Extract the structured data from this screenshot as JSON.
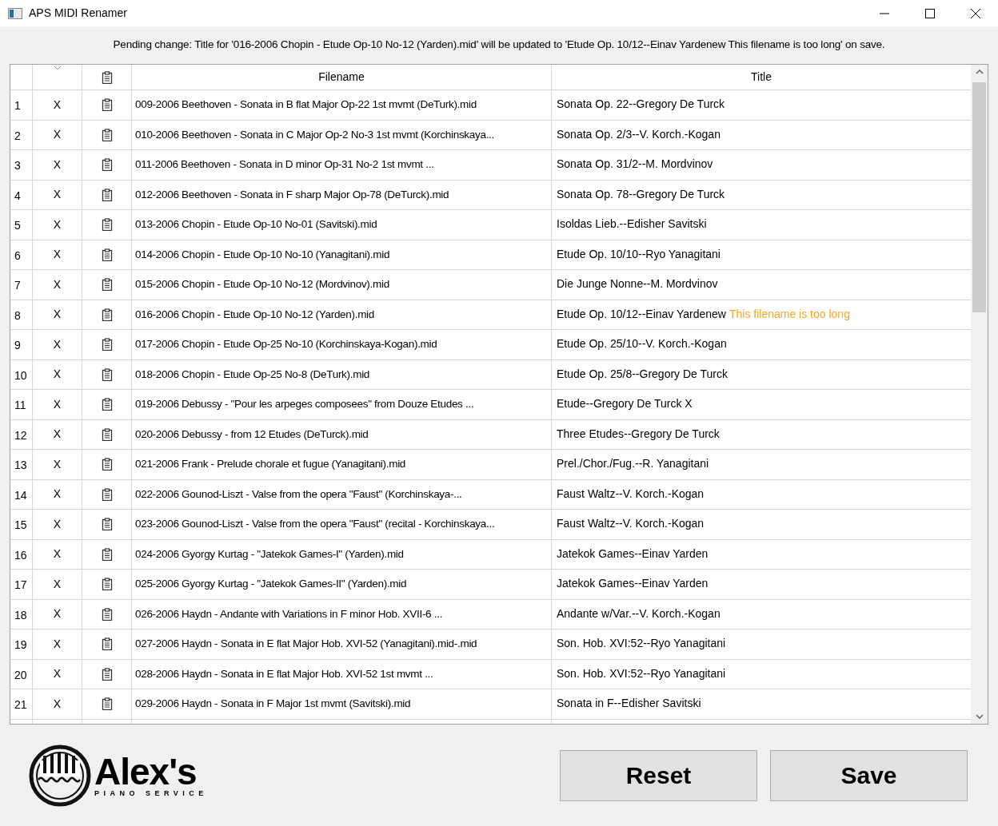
{
  "window": {
    "title": "APS MIDI Renamer"
  },
  "pending_change": "Pending change: Title for '016-2006 Chopin - Etude Op-10 No-12 (Yarden).mid' will be updated to 'Etude Op. 10/12--Einav Yardenew This filename is too long' on save.",
  "table": {
    "columns": [
      "Filename",
      "Title"
    ],
    "rows": [
      {
        "number": "1",
        "mark": "X",
        "filename": "009-2006 Beethoven - Sonata in B flat Major Op-22 1st mvmt (DeTurk).mid",
        "title": "Sonata Op. 22--Gregory De Turck"
      },
      {
        "number": "2",
        "mark": "X",
        "filename": "010-2006 Beethoven - Sonata in C Major Op-2 No-3 1st mvmt (Korchinskaya...",
        "title": "Sonata Op. 2/3--V. Korch.-Kogan"
      },
      {
        "number": "3",
        "mark": "X",
        "filename": "011-2006 Beethoven - Sonata in D minor Op-31 No-2 1st mvmt ...",
        "title": "Sonata Op. 31/2--M. Mordvinov"
      },
      {
        "number": "4",
        "mark": "X",
        "filename": "012-2006 Beethoven - Sonata in F sharp Major Op-78 (DeTurck).mid",
        "title": "Sonata Op. 78--Gregory De Turck"
      },
      {
        "number": "5",
        "mark": "X",
        "filename": "013-2006 Chopin - Etude Op-10 No-01 (Savitski).mid",
        "title": "Isoldas Lieb.--Edisher Savitski"
      },
      {
        "number": "6",
        "mark": "X",
        "filename": "014-2006 Chopin - Etude Op-10 No-10 (Yanagitani).mid",
        "title": "Etude Op. 10/10--Ryo Yanagitani"
      },
      {
        "number": "7",
        "mark": "X",
        "filename": "015-2006 Chopin - Etude Op-10 No-12 (Mordvinov).mid",
        "title": "Die Junge Nonne--M. Mordvinov"
      },
      {
        "number": "8",
        "mark": "X",
        "filename": "016-2006 Chopin - Etude Op-10 No-12 (Yarden).mid",
        "title": "Etude Op. 10/12--Einav Yardenew",
        "warning": "This filename is too long"
      },
      {
        "number": "9",
        "mark": "X",
        "filename": "017-2006 Chopin - Etude Op-25 No-10 (Korchinskaya-Kogan).mid",
        "title": "Etude Op. 25/10--V. Korch.-Kogan"
      },
      {
        "number": "10",
        "mark": "X",
        "filename": "018-2006 Chopin - Etude Op-25 No-8 (DeTurk).mid",
        "title": "Etude Op. 25/8--Gregory De Turck"
      },
      {
        "number": "11",
        "mark": "X",
        "filename": "019-2006 Debussy - \"Pour les arpeges composees\" from Douze Etudes ...",
        "title": "Etude--Gregory De Turck X"
      },
      {
        "number": "12",
        "mark": "X",
        "filename": "020-2006 Debussy - from 12 Etudes (DeTurck).mid",
        "title": "Three Etudes--Gregory De Turck"
      },
      {
        "number": "13",
        "mark": "X",
        "filename": "021-2006 Frank - Prelude chorale et fugue (Yanagitani).mid",
        "title": "Prel./Chor./Fug.--R. Yanagitani"
      },
      {
        "number": "14",
        "mark": "X",
        "filename": "022-2006 Gounod-Liszt - Valse from the opera \"Faust\" (Korchinskaya-...",
        "title": "Faust Waltz--V. Korch.-Kogan"
      },
      {
        "number": "15",
        "mark": "X",
        "filename": "023-2006 Gounod-Liszt - Valse from the opera \"Faust\" (recital - Korchinskaya...",
        "title": "Faust Waltz--V. Korch.-Kogan"
      },
      {
        "number": "16",
        "mark": "X",
        "filename": "024-2006 Gyorgy Kurtag - \"Jatekok Games-I\" (Yarden).mid",
        "title": "Jatekok Games--Einav Yarden"
      },
      {
        "number": "17",
        "mark": "X",
        "filename": "025-2006 Gyorgy Kurtag - \"Jatekok Games-II\" (Yarden).mid",
        "title": "Jatekok Games--Einav Yarden"
      },
      {
        "number": "18",
        "mark": "X",
        "filename": "026-2006 Haydn - Andante with Variations in F minor Hob. XVII-6 ...",
        "title": "Andante w/Var.--V. Korch.-Kogan"
      },
      {
        "number": "19",
        "mark": "X",
        "filename": "027-2006 Haydn - Sonata in E flat Major Hob. XVI-52 (Yanagitani).mid-.mid",
        "title": "Son. Hob. XVI:52--Ryo Yanagitani"
      },
      {
        "number": "20",
        "mark": "X",
        "filename": "028-2006 Haydn - Sonata in E flat Major Hob. XVI-52 1st mvmt ...",
        "title": "Son. Hob. XVI:52--Ryo Yanagitani"
      },
      {
        "number": "21",
        "mark": "X",
        "filename": "029-2006 Haydn - Sonata in F Major 1st mvmt (Savitski).mid",
        "title": "Sonata in F--Edisher Savitski"
      }
    ]
  },
  "logo": {
    "name": "Alex's",
    "tagline": "PIANO SERVICE"
  },
  "buttons": [
    "Reset",
    "Save"
  ]
}
